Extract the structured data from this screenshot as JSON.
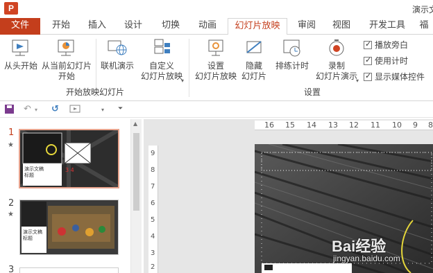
{
  "app": {
    "icon_letter": "P",
    "window_title": "演示文"
  },
  "tabs": [
    {
      "id": "file",
      "label": "文件"
    },
    {
      "id": "home",
      "label": "开始"
    },
    {
      "id": "insert",
      "label": "插入"
    },
    {
      "id": "design",
      "label": "设计"
    },
    {
      "id": "transitions",
      "label": "切换"
    },
    {
      "id": "animations",
      "label": "动画"
    },
    {
      "id": "slideshow",
      "label": "幻灯片放映"
    },
    {
      "id": "review",
      "label": "审阅"
    },
    {
      "id": "view",
      "label": "视图"
    },
    {
      "id": "developer",
      "label": "开发工具"
    },
    {
      "id": "more",
      "label": "福"
    }
  ],
  "active_tab": "幻灯片放映",
  "ribbon": {
    "start_group": {
      "label": "开始放映幻灯片",
      "from_beginning": "从头开始",
      "from_current_1": "从当前幻灯片",
      "from_current_2": "开始",
      "online_present": "联机演示",
      "custom_1": "自定义",
      "custom_2": "幻灯片放映"
    },
    "setup_group": {
      "label": "设置",
      "setup_1": "设置",
      "setup_2": "幻灯片放映",
      "hide_1": "隐藏",
      "hide_2": "幻灯片",
      "rehearse": "排练计时",
      "record_1": "录制",
      "record_2": "幻灯片演示"
    },
    "checkboxes": [
      {
        "label": "播放旁白",
        "checked": true
      },
      {
        "label": "使用计时",
        "checked": true
      },
      {
        "label": "显示媒体控件",
        "checked": true
      }
    ]
  },
  "slides": [
    {
      "number": "1",
      "has_star": true,
      "selected": true,
      "title_text": "演示文稿\n标题"
    },
    {
      "number": "2",
      "has_star": true,
      "selected": false,
      "title_text": "演示文稿\n标题"
    },
    {
      "number": "3",
      "has_star": false,
      "selected": false
    }
  ],
  "rulers": {
    "horizontal": [
      "16",
      "15",
      "14",
      "13",
      "12",
      "11",
      "10",
      "9",
      "8"
    ],
    "vertical": [
      "9",
      "8",
      "7",
      "6",
      "5",
      "4",
      "3",
      "2"
    ]
  },
  "watermark": {
    "brand": "Bai经验",
    "url": "jingyan.baidu.com"
  },
  "colors": {
    "accent": "#c43e1c",
    "selection": "#e8a48e"
  }
}
